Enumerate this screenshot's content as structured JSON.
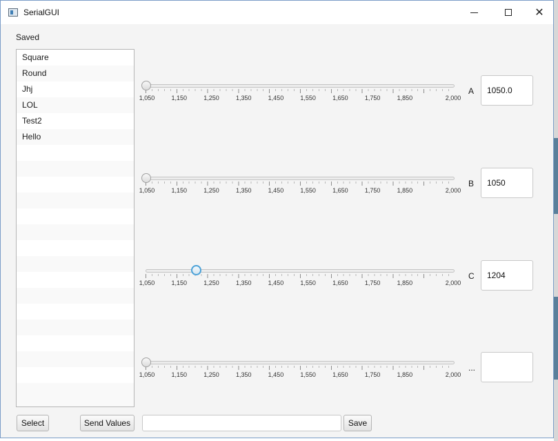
{
  "window": {
    "title": "SerialGUI"
  },
  "saved_label": "Saved",
  "saved_list": {
    "items": [
      "Square",
      "Round",
      "Jhj",
      "LOL",
      "Test2",
      "Hello"
    ],
    "empty_rows": 16
  },
  "tick_labels": [
    "1,050",
    "1,150",
    "1,250",
    "1,350",
    "1,450",
    "1,550",
    "1,650",
    "1,750",
    "1,850",
    "2,000"
  ],
  "slider_range": {
    "min": 1050,
    "max": 2000
  },
  "sliders": [
    {
      "letter": "A",
      "value": 1050,
      "field": "1050.0",
      "focused": false
    },
    {
      "letter": "B",
      "value": 1050,
      "field": "1050",
      "focused": false
    },
    {
      "letter": "C",
      "value": 1204,
      "field": "1204",
      "focused": true
    },
    {
      "letter": "...",
      "value": 1050,
      "field": "",
      "focused": false
    }
  ],
  "buttons": {
    "select": "Select",
    "send_values": "Send Values",
    "save": "Save"
  },
  "name_input": {
    "value": ""
  },
  "icons": {
    "app": "app-window-icon",
    "minimize": "minimize-icon",
    "maximize": "maximize-icon",
    "close": "close-icon"
  }
}
